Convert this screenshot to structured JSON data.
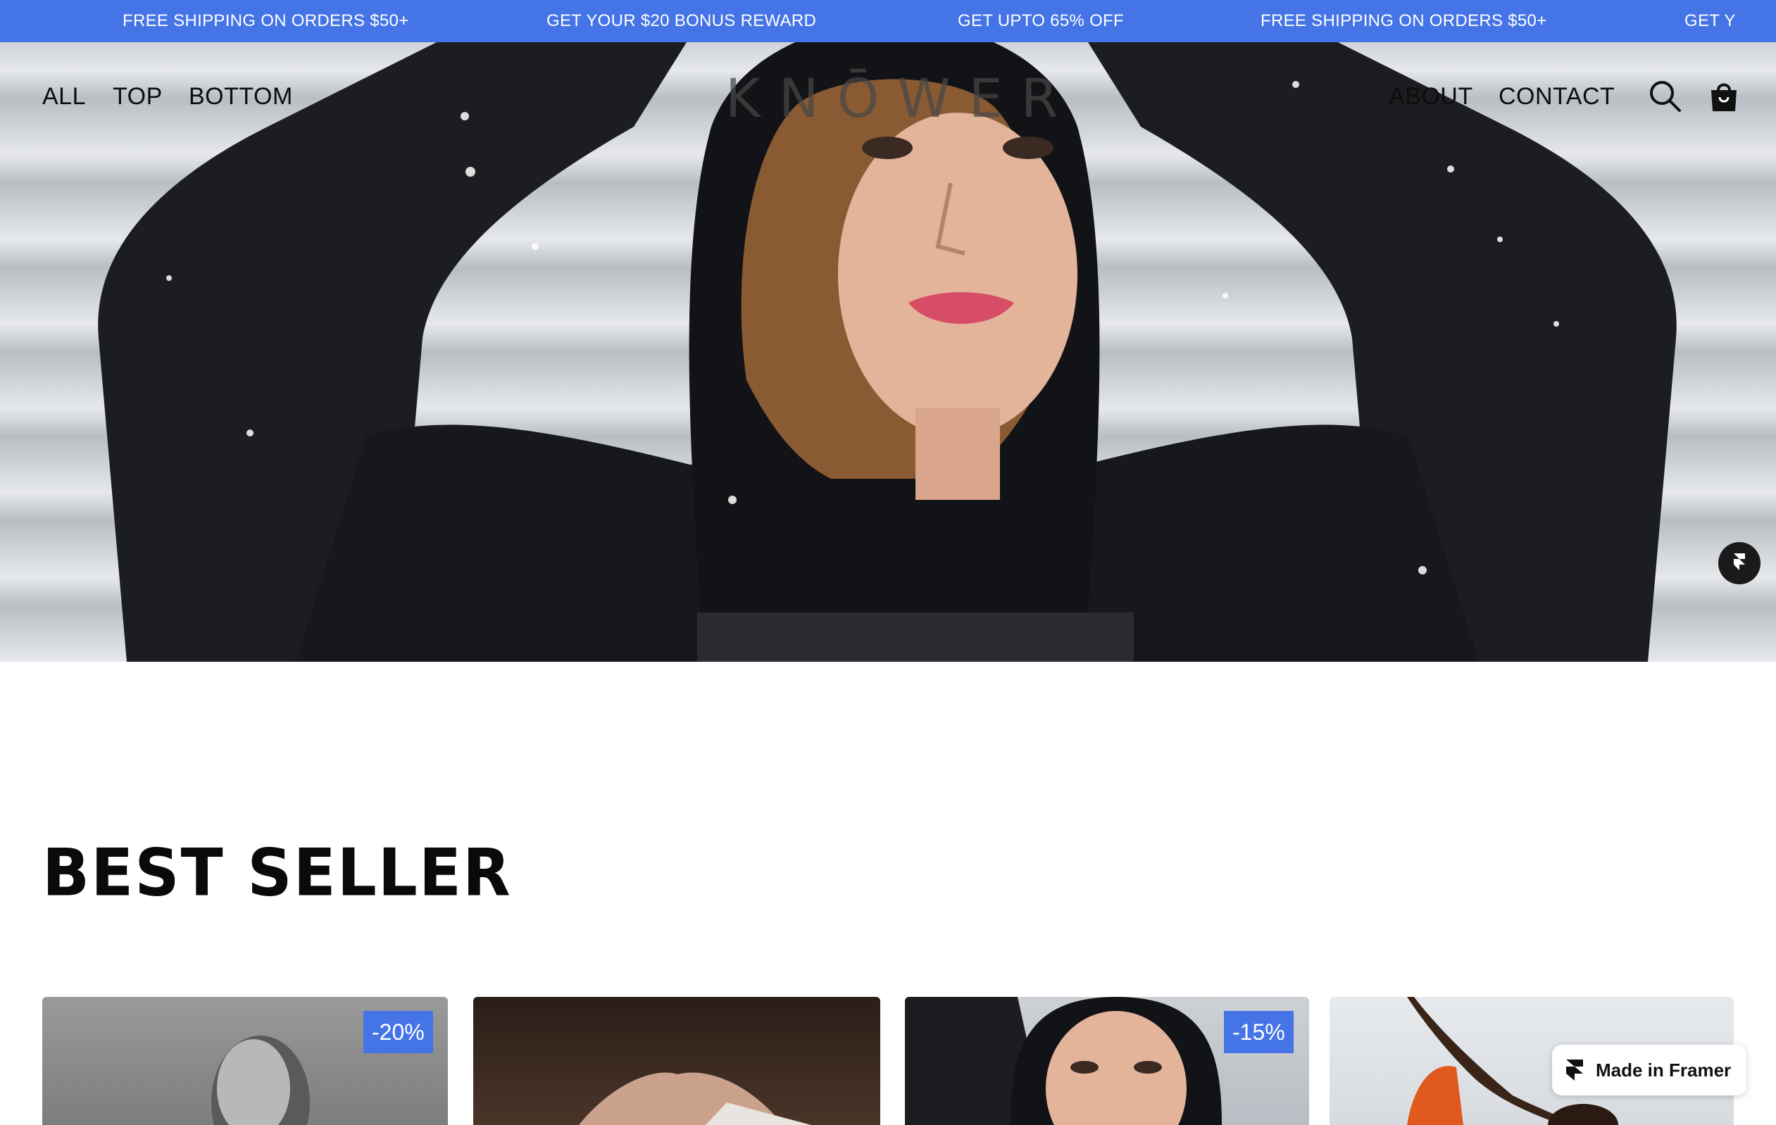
{
  "announcement": {
    "items": [
      "FREE SHIPPING ON ORDERS $50+",
      "GET YOUR $20 BONUS REWARD",
      "GET UPTO 65% OFF",
      "FREE SHIPPING ON ORDERS $50+",
      "GET Y"
    ]
  },
  "nav": {
    "left": [
      "ALL",
      "TOP",
      "BOTTOM"
    ],
    "right": [
      "ABOUT",
      "CONTACT"
    ],
    "logo": "KNŌWER"
  },
  "icons": {
    "search": "search-icon",
    "cart": "shopping-bag-icon",
    "framer": "framer-icon"
  },
  "section": {
    "title": "BEST SELLER"
  },
  "products": [
    {
      "badge": "-20%"
    },
    {
      "badge": ""
    },
    {
      "badge": "-15%"
    },
    {
      "badge": ""
    }
  ],
  "framer_badge": {
    "label": "Made in Framer"
  },
  "colors": {
    "accent": "#4474e6",
    "text": "#0d0d0d",
    "background": "#ffffff"
  }
}
